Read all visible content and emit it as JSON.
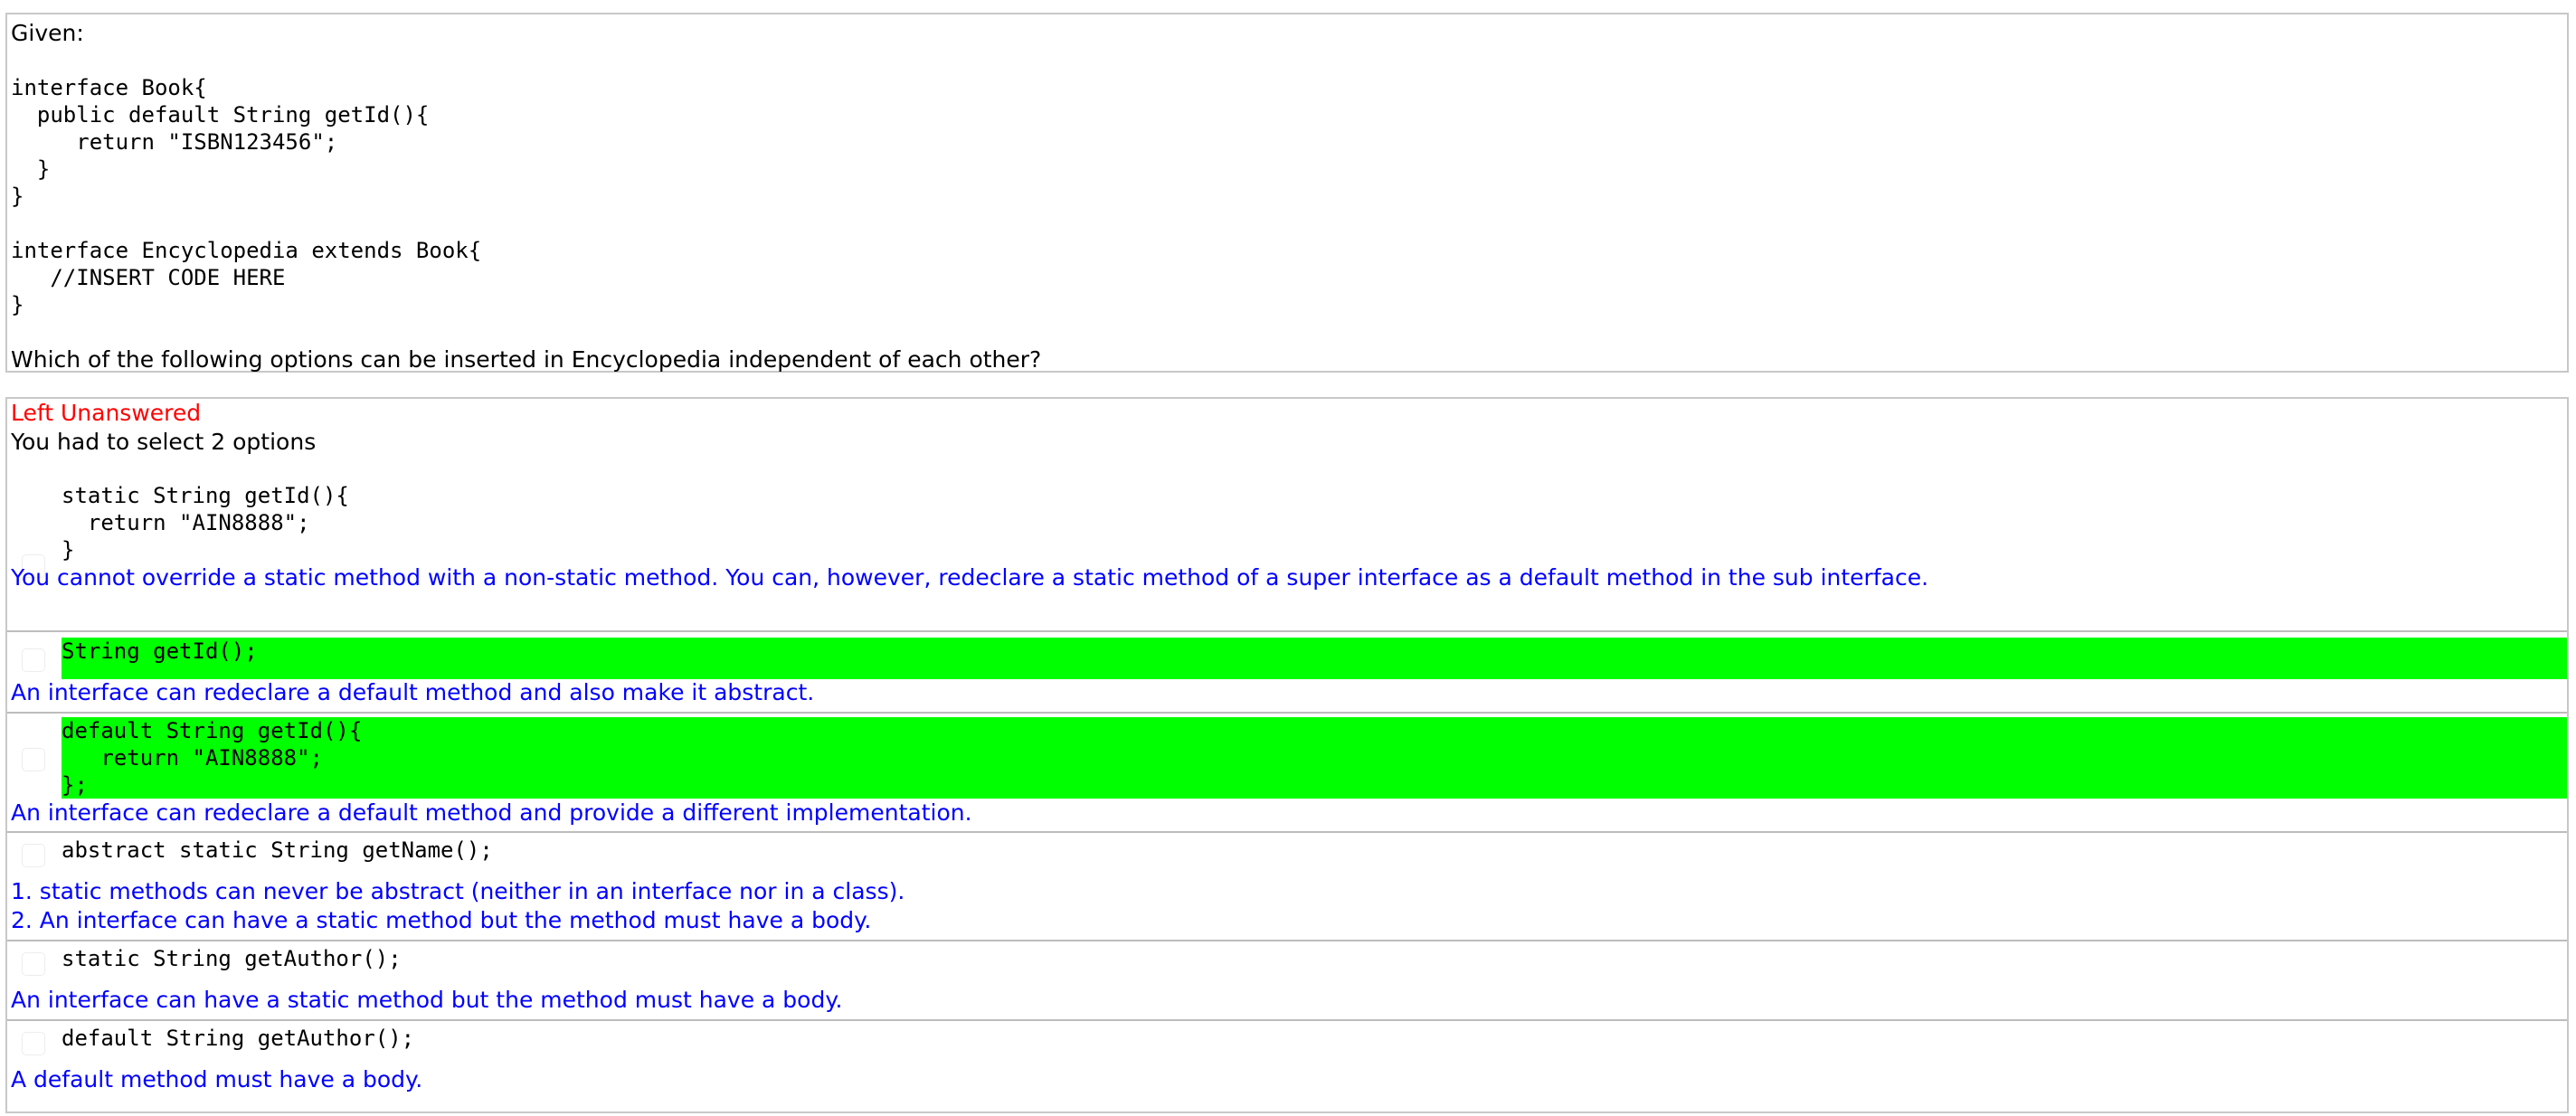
{
  "question": {
    "given_label": "Given:",
    "code_lines": [
      "interface Book{",
      "  public default String getId(){",
      "     return \"ISBN123456\";",
      "  }",
      "}",
      "",
      "interface Encyclopedia extends Book{",
      "   //INSERT CODE HERE",
      "}"
    ],
    "prompt": "Which of the following options can be inserted in Encyclopedia independent of each other?"
  },
  "answer": {
    "status": "Left Unanswered",
    "instruction": "You had to select 2 options",
    "highlight_color": "#00ff00",
    "status_color": "#ff0000",
    "explanation_color": "#0000ff",
    "options": [
      {
        "code_lines": [
          "static String getId(){",
          "  return \"AIN8888\";",
          "}"
        ],
        "correct": false,
        "explanation": [
          "You cannot override a static method with a non-static method. You can, however, redeclare a static method of a super interface as a default method in the sub interface."
        ]
      },
      {
        "code_lines": [
          "String getId();"
        ],
        "correct": true,
        "explanation": [
          "An interface can redeclare a default method and also make it abstract."
        ]
      },
      {
        "code_lines": [
          "default String getId(){",
          "   return \"AIN8888\";",
          "};"
        ],
        "correct": true,
        "explanation": [
          "An interface can redeclare a default method and provide a different implementation."
        ]
      },
      {
        "code_lines": [
          "abstract static String getName();"
        ],
        "correct": false,
        "explanation": [
          "1. static methods can never be abstract (neither in an interface nor in a class).",
          "2. An interface can have a static method but the method must have a body."
        ]
      },
      {
        "code_lines": [
          "static String getAuthor();"
        ],
        "correct": false,
        "explanation": [
          "An interface can have a static method but the method must have a body."
        ]
      },
      {
        "code_lines": [
          "default String getAuthor();"
        ],
        "correct": false,
        "explanation": [
          "A default method must have a body."
        ]
      }
    ]
  }
}
